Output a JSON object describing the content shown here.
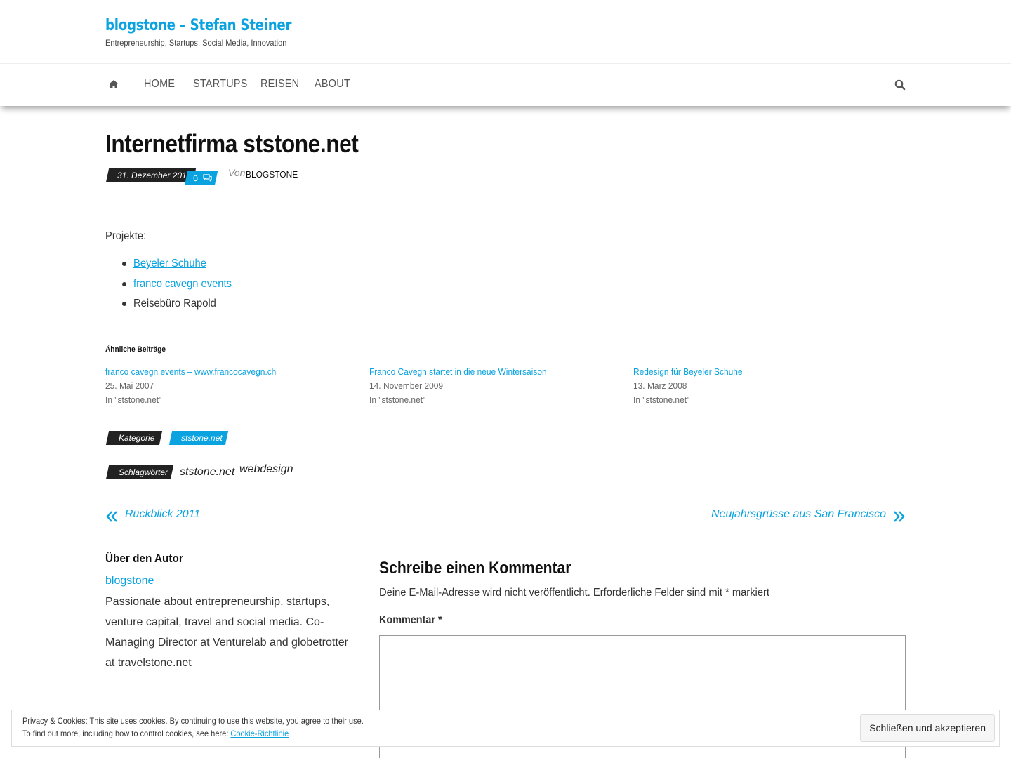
{
  "header": {
    "site_title": "blogstone – Stefan Steiner",
    "site_description": "Entrepreneurship, Startups, Social Media, Innovation"
  },
  "nav": {
    "items": [
      {
        "label": "Home"
      },
      {
        "label": "Startups"
      },
      {
        "label": "Reisen"
      },
      {
        "label": "About"
      }
    ],
    "icons": {
      "home": "home-icon",
      "search": "search-icon"
    }
  },
  "post": {
    "title": "Internetfirma ststone.net",
    "date": "31. Dezember 2011",
    "comment_count": "0",
    "byline_prefix": "Von",
    "author": "blogstone",
    "intro": "Projekte:",
    "projects": [
      {
        "label": "Beyeler Schuhe",
        "linked": true
      },
      {
        "label": "franco cavegn events",
        "linked": true
      },
      {
        "label": "Reisebüro Rapold",
        "linked": false
      }
    ]
  },
  "related": {
    "heading": "Ähnliche Beiträge",
    "items": [
      {
        "title": "franco cavegn events – www.francocavegn.ch",
        "date": "25. Mai 2007",
        "category": "In \"ststone.net\""
      },
      {
        "title": "Franco Cavegn startet in die neue Wintersaison",
        "date": "14. November 2009",
        "category": "In \"ststone.net\""
      },
      {
        "title": "Redesign für Beyeler Schuhe",
        "date": "13. März 2008",
        "category": "In \"ststone.net\""
      }
    ]
  },
  "meta": {
    "category_label": "Kategorie",
    "category_value": "ststone.net",
    "tags_label": "Schlagwörter",
    "tags": [
      "ststone.net",
      "webdesign"
    ]
  },
  "post_nav": {
    "prev": "Rückblick 2011",
    "next": "Neujahrsgrüsse aus San Francisco"
  },
  "author_box": {
    "heading": "Über den Autor",
    "name": "blogstone",
    "bio": "Passionate about entrepreneurship, startups, venture capital, travel and social media. Co-Managing Director at Venturelab and globetrotter at travelstone.net"
  },
  "comment_form": {
    "heading": "Schreibe einen Kommentar",
    "note": "Deine E-Mail-Adresse wird nicht veröffentlicht. Erforderliche Felder sind mit * markiert",
    "label": "Kommentar",
    "required_mark": "*"
  },
  "cookie_notice": {
    "line1": "Privacy & Cookies: This site uses cookies. By continuing to use this website, you agree to their use.",
    "line2_prefix": "To find out more, including how to control cookies, see here:",
    "link": "Cookie-Richtlinie",
    "button": "Schließen und akzeptieren"
  },
  "colors": {
    "accent": "#0aa3e0",
    "dark_tag": "#222222",
    "text": "#333333"
  }
}
